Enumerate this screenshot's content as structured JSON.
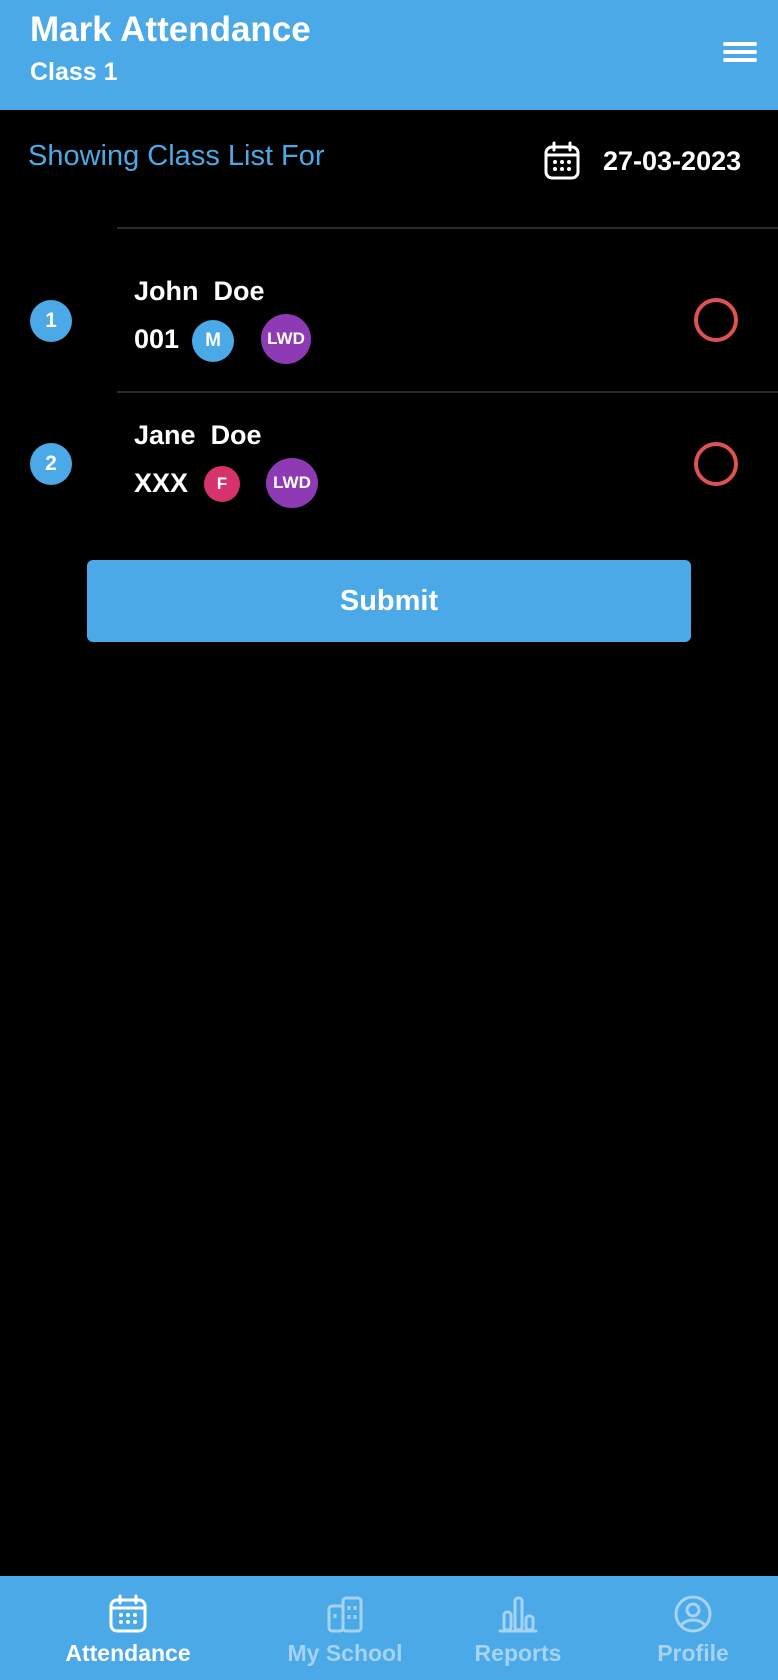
{
  "header": {
    "title": "Mark Attendance",
    "subtitle": "Class 1",
    "menu_icon": "hamburger-menu-icon"
  },
  "list_header": {
    "label": "Showing Class List For",
    "date": "27-03-2023",
    "calendar_icon": "calendar-icon"
  },
  "students": [
    {
      "number": "1",
      "first_name": "John",
      "last_name": "Doe",
      "id": "001",
      "gender": "M",
      "tag": "LWD",
      "marked": false
    },
    {
      "number": "2",
      "first_name": "Jane",
      "last_name": "Doe",
      "id": "XXX",
      "gender": "F",
      "tag": "LWD",
      "marked": false
    }
  ],
  "submit_label": "Submit",
  "tabs": [
    {
      "label": "Attendance",
      "icon": "calendar-icon",
      "active": true
    },
    {
      "label": "My School",
      "icon": "school-building-icon",
      "active": false
    },
    {
      "label": "Reports",
      "icon": "bar-chart-icon",
      "active": false
    },
    {
      "label": "Profile",
      "icon": "user-circle-icon",
      "active": false
    }
  ],
  "colors": {
    "primary": "#4aa9e6",
    "background": "#000000",
    "male_badge": "#4aa9e6",
    "female_badge": "#d6336c",
    "lwd_badge": "#8e3ab5",
    "radio_ring": "#e05252",
    "tab_inactive_text": "#a5d3f2"
  }
}
